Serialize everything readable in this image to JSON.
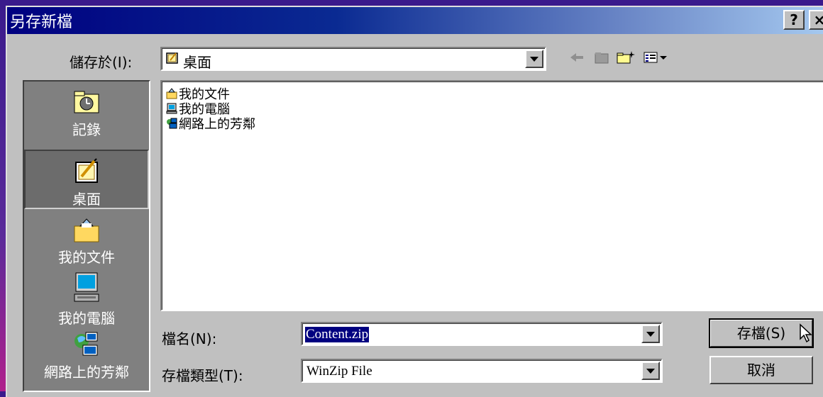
{
  "window": {
    "title": "另存新檔"
  },
  "titlebar": {
    "help_glyph": "?",
    "close_glyph": "×"
  },
  "save_in": {
    "label": "儲存於(I):",
    "value": "桌面",
    "icon": "desktop-icon"
  },
  "toolbar": {
    "icons": [
      "back-arrow-icon",
      "up-folder-icon",
      "new-folder-icon",
      "view-menu-icon"
    ]
  },
  "places": [
    {
      "label": "記錄",
      "icon": "history-icon",
      "selected": false
    },
    {
      "label": "桌面",
      "icon": "desktop-icon",
      "selected": true
    },
    {
      "label": "我的文件",
      "icon": "my-documents-icon",
      "selected": false
    },
    {
      "label": "我的電腦",
      "icon": "my-computer-icon",
      "selected": false
    },
    {
      "label": "網路上的芳鄰",
      "icon": "network-neighborhood-icon",
      "selected": false
    }
  ],
  "files": [
    {
      "name": "我的文件",
      "icon": "my-documents-icon"
    },
    {
      "name": "我的電腦",
      "icon": "my-computer-icon"
    },
    {
      "name": "網路上的芳鄰",
      "icon": "network-neighborhood-icon"
    }
  ],
  "filename": {
    "label": "檔名(N):",
    "value": "Content.zip"
  },
  "filetype": {
    "label": "存檔類型(T):",
    "value": "WinZip File"
  },
  "buttons": {
    "save": "存檔(S)",
    "cancel": "取消"
  },
  "colors": {
    "title_start": "#000080",
    "title_end": "#a6caf0",
    "face": "#c0c0c0",
    "selection": "#000080"
  }
}
